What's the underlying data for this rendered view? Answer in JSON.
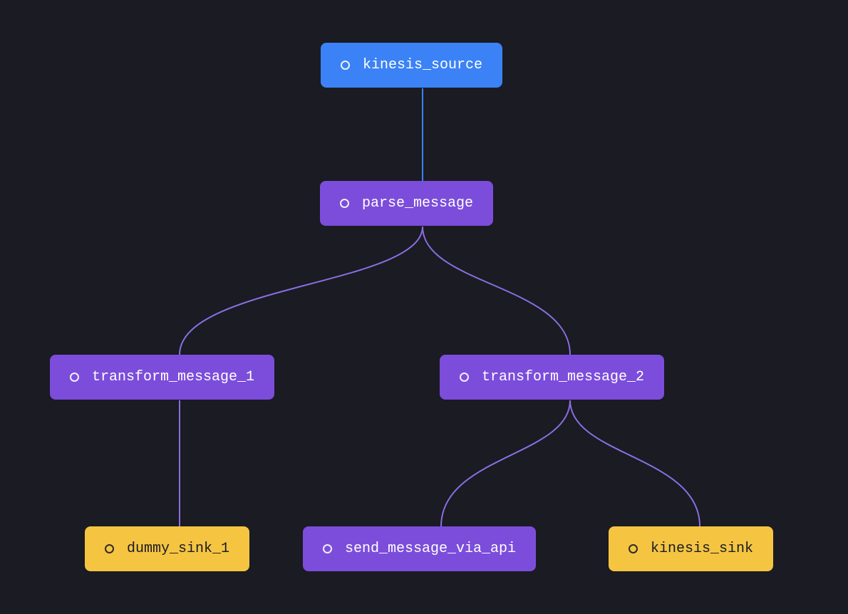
{
  "nodes": {
    "kinesis_source": {
      "label": "kinesis_source"
    },
    "parse_message": {
      "label": "parse_message"
    },
    "transform_message_1": {
      "label": "transform_message_1"
    },
    "transform_message_2": {
      "label": "transform_message_2"
    },
    "dummy_sink_1": {
      "label": "dummy_sink_1"
    },
    "send_message_via_api": {
      "label": "send_message_via_api"
    },
    "kinesis_sink": {
      "label": "kinesis_sink"
    }
  },
  "edges": [
    {
      "from": "kinesis_source",
      "to": "parse_message"
    },
    {
      "from": "parse_message",
      "to": "transform_message_1"
    },
    {
      "from": "parse_message",
      "to": "transform_message_2"
    },
    {
      "from": "transform_message_1",
      "to": "dummy_sink_1"
    },
    {
      "from": "transform_message_2",
      "to": "send_message_via_api"
    },
    {
      "from": "transform_message_2",
      "to": "kinesis_sink"
    }
  ],
  "colors": {
    "edge_blue": "#3b82f6",
    "edge_purple": "#8a6ee0"
  }
}
